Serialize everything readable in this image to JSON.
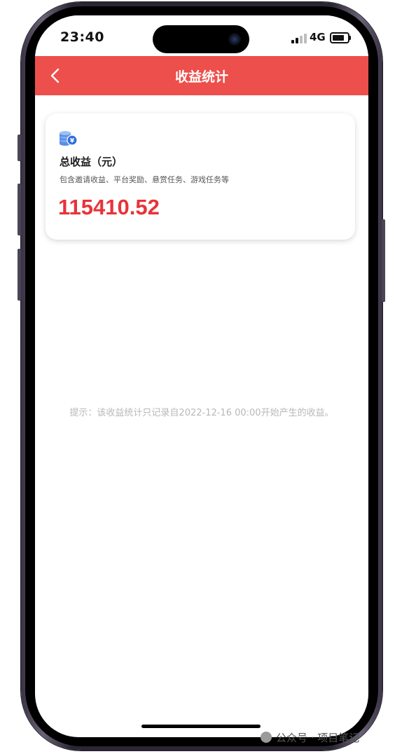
{
  "status_bar": {
    "time": "23:40",
    "network": "4G",
    "signal_icon": "cellular-signal-icon",
    "battery_icon": "battery-icon",
    "battery_level": 0.8
  },
  "header": {
    "title": "收益统计",
    "back_icon": "chevron-left-icon",
    "background_color": "#ec4f4c"
  },
  "card": {
    "icon": "coin-stack-yen-icon",
    "title": "总收益（元）",
    "subtitle": "包含邀请收益、平台奖励、悬赏任务、游戏任务等",
    "amount": "115410.52",
    "amount_color": "#e8333a"
  },
  "hint": "提示：该收益统计只记录自2022-12-16 00:00开始产生的收益。",
  "watermark": {
    "text": "公众号 · 项目笔记"
  }
}
